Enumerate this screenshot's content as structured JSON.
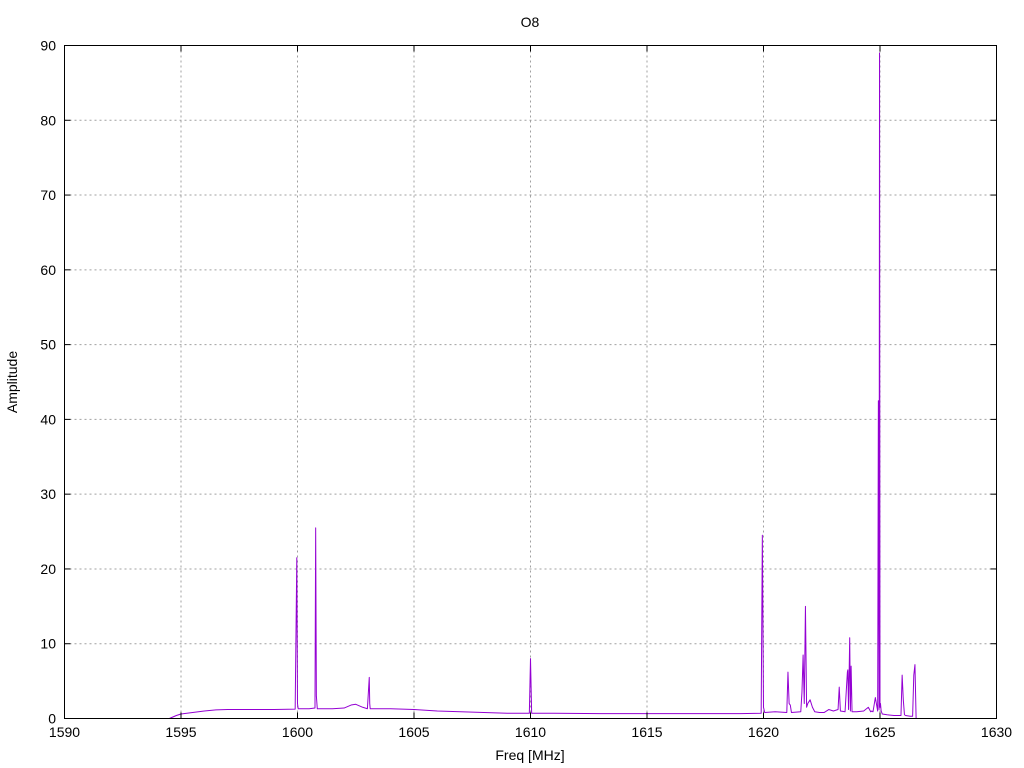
{
  "chart_data": {
    "type": "line",
    "title": "O8",
    "xlabel": "Freq [MHz]",
    "ylabel": "Amplitude",
    "xlim": [
      1590,
      1630
    ],
    "ylim": [
      0,
      90
    ],
    "xticks": [
      "1590",
      "1595",
      "1600",
      "1605",
      "1610",
      "1615",
      "1620",
      "1625",
      "1630"
    ],
    "yticks": [
      "0",
      "10",
      "20",
      "30",
      "40",
      "50",
      "60",
      "70",
      "80",
      "90"
    ],
    "grid": true,
    "legend": "none",
    "series": [
      {
        "color": "#9400d3",
        "x": [
          1594.5,
          1594.8,
          1595.0,
          1595.5,
          1596.0,
          1596.5,
          1597.0,
          1598.0,
          1599.0,
          1599.9,
          1599.97,
          1600.0,
          1600.03,
          1600.1,
          1600.5,
          1600.75,
          1600.78,
          1600.81,
          1600.85,
          1601.0,
          1601.5,
          1602.0,
          1602.3,
          1602.5,
          1602.8,
          1603.0,
          1603.08,
          1603.1,
          1603.12,
          1603.2,
          1604.0,
          1605.0,
          1606.0,
          1607.0,
          1608.0,
          1609.0,
          1609.95,
          1610.0,
          1610.05,
          1611.0,
          1613.0,
          1615.0,
          1617.0,
          1619.0,
          1619.9,
          1619.95,
          1620.0,
          1620.05,
          1620.5,
          1621.0,
          1621.05,
          1621.1,
          1621.15,
          1621.2,
          1621.6,
          1621.65,
          1621.7,
          1621.75,
          1621.8,
          1621.85,
          1621.9,
          1622.0,
          1622.1,
          1622.2,
          1622.4,
          1622.6,
          1622.8,
          1623.0,
          1623.2,
          1623.25,
          1623.3,
          1623.5,
          1623.6,
          1623.62,
          1623.65,
          1623.7,
          1623.73,
          1623.76,
          1623.8,
          1624.0,
          1624.3,
          1624.5,
          1624.6,
          1624.65,
          1624.7,
          1624.8,
          1624.9,
          1624.93,
          1624.96,
          1624.98,
          1625.0,
          1625.02,
          1625.05,
          1625.1,
          1625.3,
          1625.6,
          1625.9,
          1625.95,
          1626.0,
          1626.05,
          1626.1,
          1626.3,
          1626.4,
          1626.45,
          1626.5,
          1626.55
        ],
        "y": [
          0.0,
          0.4,
          0.6,
          0.8,
          1.0,
          1.15,
          1.2,
          1.2,
          1.2,
          1.25,
          21.5,
          2.0,
          1.3,
          1.3,
          1.3,
          1.4,
          25.5,
          3.0,
          1.3,
          1.3,
          1.3,
          1.4,
          1.8,
          1.9,
          1.5,
          1.3,
          5.5,
          2.0,
          1.3,
          1.3,
          1.3,
          1.2,
          1.0,
          0.9,
          0.8,
          0.7,
          0.7,
          8.0,
          0.7,
          0.7,
          0.65,
          0.65,
          0.65,
          0.65,
          0.7,
          24.5,
          1.5,
          0.8,
          0.9,
          0.8,
          6.2,
          2.0,
          1.8,
          0.8,
          0.9,
          3.5,
          8.5,
          2.0,
          15.0,
          1.5,
          2.0,
          2.5,
          1.5,
          0.9,
          0.8,
          0.8,
          1.2,
          1.0,
          1.2,
          4.2,
          1.0,
          0.9,
          6.2,
          6.5,
          1.2,
          10.8,
          1.0,
          7.0,
          0.9,
          0.9,
          1.0,
          1.5,
          0.9,
          1.0,
          0.9,
          2.8,
          1.0,
          42.5,
          1.2,
          89.0,
          1.5,
          2.0,
          1.0,
          0.6,
          0.5,
          0.4,
          0.4,
          5.8,
          2.5,
          0.5,
          0.4,
          0.3,
          0.3,
          5.8,
          7.2,
          0.0
        ]
      }
    ]
  }
}
